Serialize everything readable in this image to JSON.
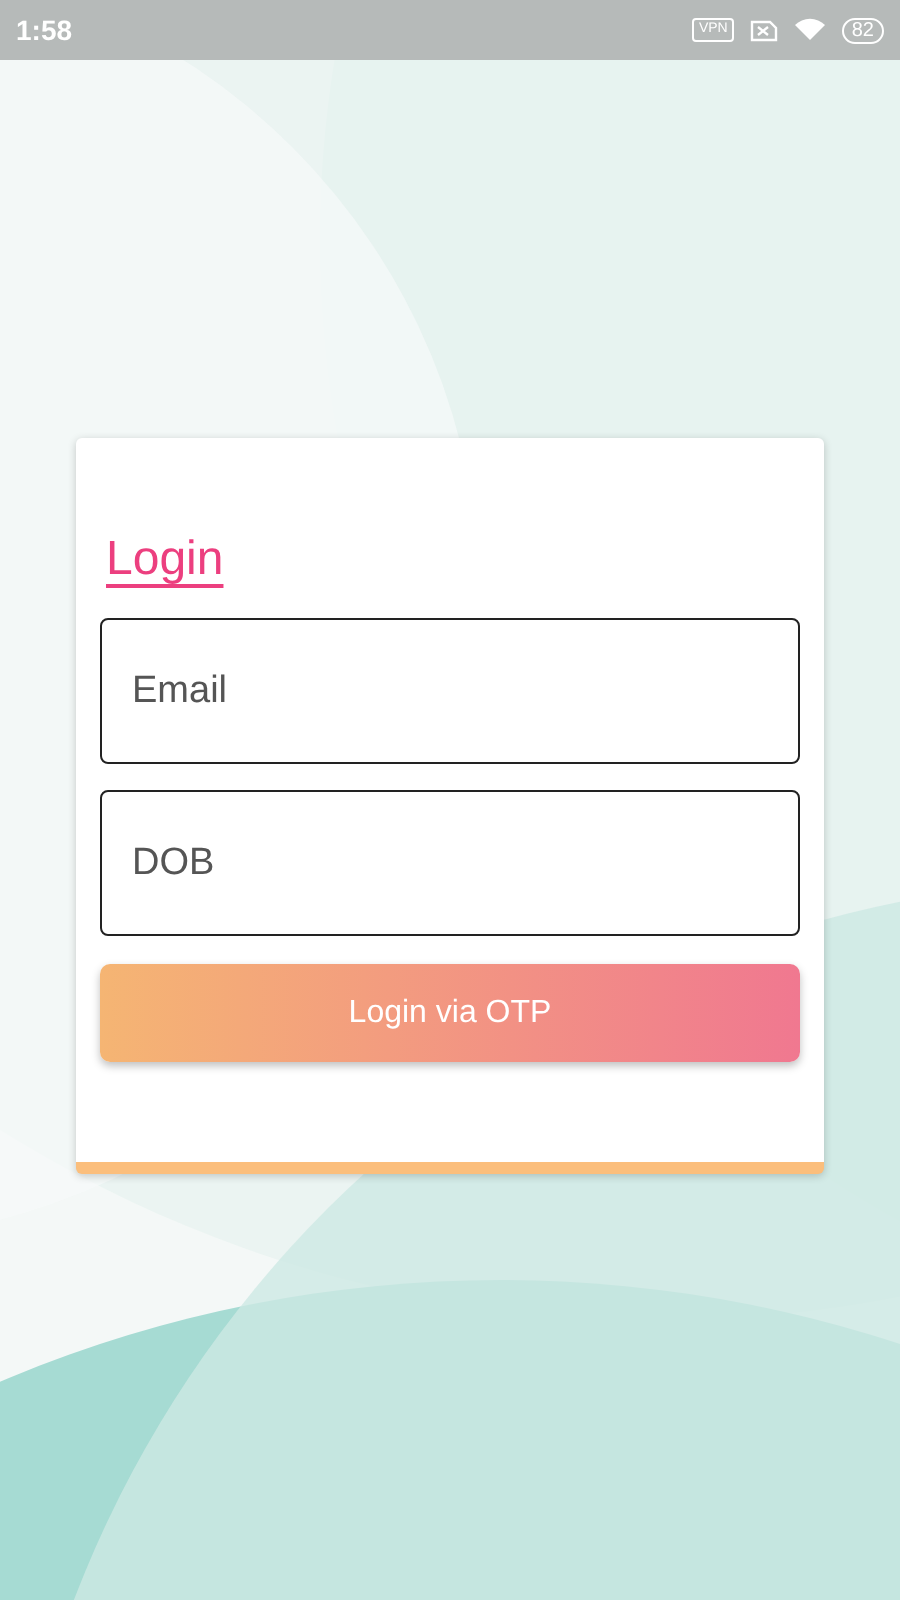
{
  "status_bar": {
    "time": "1:58",
    "vpn": "VPN",
    "battery": "82"
  },
  "login_card": {
    "title": "Login",
    "fields": [
      {
        "placeholder": "Email"
      },
      {
        "placeholder": "DOB"
      }
    ],
    "button": "Login via OTP"
  }
}
